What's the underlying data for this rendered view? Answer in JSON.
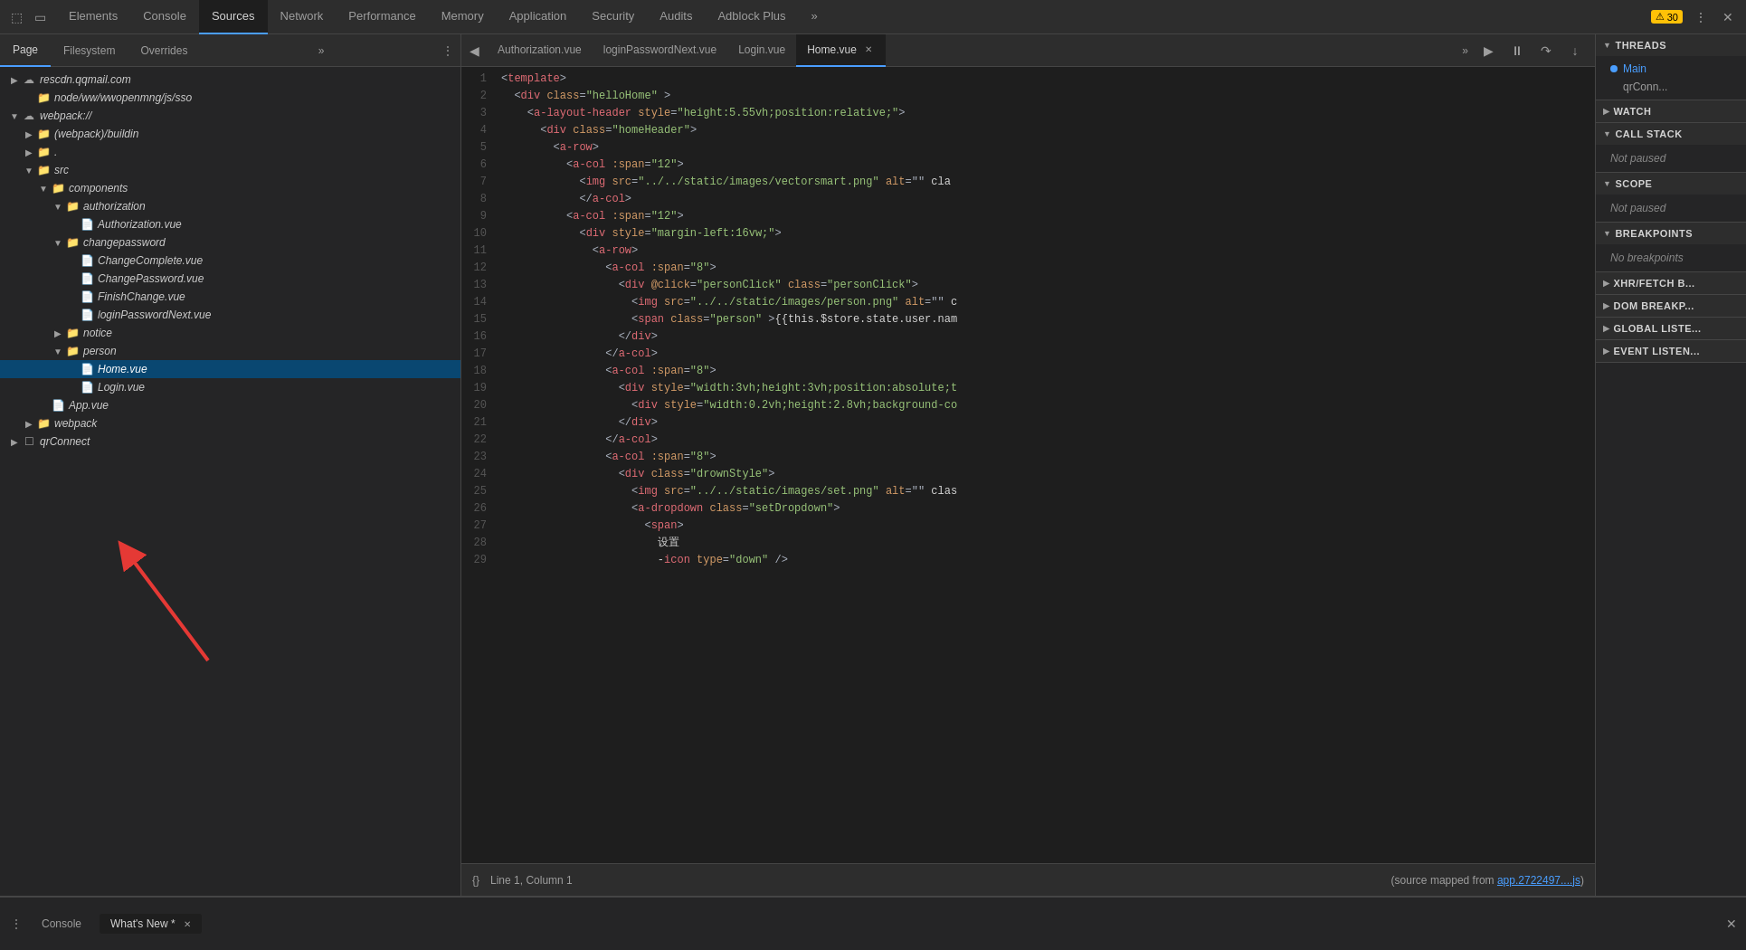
{
  "topNav": {
    "tabs": [
      {
        "label": "Elements",
        "active": false
      },
      {
        "label": "Console",
        "active": false
      },
      {
        "label": "Sources",
        "active": true
      },
      {
        "label": "Network",
        "active": false
      },
      {
        "label": "Performance",
        "active": false
      },
      {
        "label": "Memory",
        "active": false
      },
      {
        "label": "Application",
        "active": false
      },
      {
        "label": "Security",
        "active": false
      },
      {
        "label": "Audits",
        "active": false
      },
      {
        "label": "Adblock Plus",
        "active": false
      }
    ],
    "warningCount": "30",
    "moreLabel": "»"
  },
  "leftPanel": {
    "tabs": [
      {
        "label": "Page",
        "active": true
      },
      {
        "label": "Filesystem",
        "active": false
      },
      {
        "label": "Overrides",
        "active": false
      },
      {
        "label": "»",
        "active": false
      }
    ],
    "tree": [
      {
        "id": "rescdn",
        "label": "rescdn.qqmail.com",
        "indent": 0,
        "type": "cloud",
        "arrow": "closed"
      },
      {
        "id": "node_ww",
        "label": "node/ww/wwopenmng/js/sso",
        "indent": 1,
        "type": "folder-blue",
        "arrow": "none"
      },
      {
        "id": "webpack",
        "label": "webpack://",
        "indent": 0,
        "type": "cloud",
        "arrow": "open"
      },
      {
        "id": "webpack_buildin",
        "label": "(webpack)/buildin",
        "indent": 1,
        "type": "folder",
        "arrow": "closed"
      },
      {
        "id": "dot",
        "label": ".",
        "indent": 1,
        "type": "folder",
        "arrow": "closed"
      },
      {
        "id": "src",
        "label": "src",
        "indent": 1,
        "type": "folder",
        "arrow": "open"
      },
      {
        "id": "components",
        "label": "components",
        "indent": 2,
        "type": "folder",
        "arrow": "open"
      },
      {
        "id": "authorization_folder",
        "label": "authorization",
        "indent": 3,
        "type": "folder",
        "arrow": "open"
      },
      {
        "id": "authorization_file",
        "label": "Authorization.vue",
        "indent": 4,
        "type": "file",
        "arrow": "none"
      },
      {
        "id": "changepassword_folder",
        "label": "changepassword",
        "indent": 3,
        "type": "folder",
        "arrow": "open"
      },
      {
        "id": "changecomplete",
        "label": "ChangeComplete.vue",
        "indent": 4,
        "type": "file",
        "arrow": "none"
      },
      {
        "id": "changepassword_file",
        "label": "ChangePassword.vue",
        "indent": 4,
        "type": "file",
        "arrow": "none"
      },
      {
        "id": "finishchange",
        "label": "FinishChange.vue",
        "indent": 4,
        "type": "file",
        "arrow": "none"
      },
      {
        "id": "loginpasswordnext",
        "label": "loginPasswordNext.vue",
        "indent": 4,
        "type": "file",
        "arrow": "none"
      },
      {
        "id": "notice_folder",
        "label": "notice",
        "indent": 3,
        "type": "folder",
        "arrow": "closed"
      },
      {
        "id": "person_folder",
        "label": "person",
        "indent": 3,
        "type": "folder",
        "arrow": "open"
      },
      {
        "id": "home_vue",
        "label": "Home.vue",
        "indent": 4,
        "type": "file",
        "arrow": "none",
        "selected": true
      },
      {
        "id": "login_vue",
        "label": "Login.vue",
        "indent": 4,
        "type": "file",
        "arrow": "none"
      },
      {
        "id": "app_vue",
        "label": "App.vue",
        "indent": 2,
        "type": "file",
        "arrow": "none"
      },
      {
        "id": "webpack_folder",
        "label": "webpack",
        "indent": 1,
        "type": "folder",
        "arrow": "closed"
      },
      {
        "id": "qrconnect_folder",
        "label": "qrConnect",
        "indent": 0,
        "type": "folder",
        "arrow": "closed"
      }
    ]
  },
  "editorTabs": [
    {
      "label": "Authorization.vue",
      "active": false
    },
    {
      "label": "loginPasswordNext.vue",
      "active": false
    },
    {
      "label": "Login.vue",
      "active": false
    },
    {
      "label": "Home.vue",
      "active": true,
      "closeable": true
    }
  ],
  "codeLines": [
    {
      "num": 1,
      "content": [
        {
          "t": "punct",
          "v": "<"
        },
        {
          "t": "tag",
          "v": "template"
        },
        {
          "t": "punct",
          "v": ">"
        }
      ]
    },
    {
      "num": 2,
      "content": [
        {
          "t": "punct",
          "v": "  <"
        },
        {
          "t": "tag",
          "v": "div"
        },
        {
          "t": "punct",
          "v": " "
        },
        {
          "t": "attr",
          "v": "class"
        },
        {
          "t": "punct",
          "v": "="
        },
        {
          "t": "string",
          "v": "\"helloHome\""
        },
        {
          "t": "punct",
          "v": " >"
        }
      ]
    },
    {
      "num": 3,
      "content": [
        {
          "t": "punct",
          "v": "    <"
        },
        {
          "t": "tag",
          "v": "a-layout-header"
        },
        {
          "t": "punct",
          "v": " "
        },
        {
          "t": "attr",
          "v": "style"
        },
        {
          "t": "punct",
          "v": "="
        },
        {
          "t": "string",
          "v": "\"height:5.55vh;position:relative;\""
        },
        {
          "t": "punct",
          "v": ">"
        }
      ]
    },
    {
      "num": 4,
      "content": [
        {
          "t": "punct",
          "v": "      <"
        },
        {
          "t": "tag",
          "v": "div"
        },
        {
          "t": "punct",
          "v": " "
        },
        {
          "t": "attr",
          "v": "class"
        },
        {
          "t": "punct",
          "v": "="
        },
        {
          "t": "string",
          "v": "\"homeHeader"
        },
        {
          "t": "punct",
          "v": "\">"
        }
      ]
    },
    {
      "num": 5,
      "content": [
        {
          "t": "punct",
          "v": "        <"
        },
        {
          "t": "tag",
          "v": "a-row"
        },
        {
          "t": "punct",
          "v": ">"
        }
      ]
    },
    {
      "num": 6,
      "content": [
        {
          "t": "punct",
          "v": "          <"
        },
        {
          "t": "tag",
          "v": "a-col"
        },
        {
          "t": "punct",
          "v": " :"
        },
        {
          "t": "attr",
          "v": "span"
        },
        {
          "t": "punct",
          "v": "="
        },
        {
          "t": "string",
          "v": "\"12\""
        },
        {
          "t": "punct",
          "v": ">"
        }
      ]
    },
    {
      "num": 7,
      "content": [
        {
          "t": "punct",
          "v": "            <"
        },
        {
          "t": "tag",
          "v": "img"
        },
        {
          "t": "punct",
          "v": " "
        },
        {
          "t": "attr",
          "v": "src"
        },
        {
          "t": "punct",
          "v": "="
        },
        {
          "t": "string",
          "v": "\"../../static/images/vectorsmart.png\""
        },
        {
          "t": "punct",
          "v": " "
        },
        {
          "t": "attr",
          "v": "alt"
        },
        {
          "t": "punct",
          "v": "=\"\" cla"
        }
      ]
    },
    {
      "num": 8,
      "content": [
        {
          "t": "punct",
          "v": "            </"
        },
        {
          "t": "tag",
          "v": "a-col"
        },
        {
          "t": "punct",
          "v": ">"
        }
      ]
    },
    {
      "num": 9,
      "content": [
        {
          "t": "punct",
          "v": "          <"
        },
        {
          "t": "tag",
          "v": "a-col"
        },
        {
          "t": "punct",
          "v": " :"
        },
        {
          "t": "attr",
          "v": "span"
        },
        {
          "t": "punct",
          "v": "="
        },
        {
          "t": "string",
          "v": "\"12\""
        },
        {
          "t": "punct",
          "v": ">"
        }
      ]
    },
    {
      "num": 10,
      "content": [
        {
          "t": "punct",
          "v": "            <"
        },
        {
          "t": "tag",
          "v": "div"
        },
        {
          "t": "punct",
          "v": " "
        },
        {
          "t": "attr",
          "v": "style"
        },
        {
          "t": "punct",
          "v": "="
        },
        {
          "t": "string",
          "v": "\"margin-left:16vw;\""
        },
        {
          "t": "punct",
          "v": ">"
        }
      ]
    },
    {
      "num": 11,
      "content": [
        {
          "t": "punct",
          "v": "              <"
        },
        {
          "t": "tag",
          "v": "a-row"
        },
        {
          "t": "punct",
          "v": ">"
        }
      ]
    },
    {
      "num": 12,
      "content": [
        {
          "t": "punct",
          "v": "                <"
        },
        {
          "t": "tag",
          "v": "a-col"
        },
        {
          "t": "punct",
          "v": " :"
        },
        {
          "t": "attr",
          "v": "span"
        },
        {
          "t": "punct",
          "v": "="
        },
        {
          "t": "string",
          "v": "\"8\""
        },
        {
          "t": "punct",
          "v": ">"
        }
      ]
    },
    {
      "num": 13,
      "content": [
        {
          "t": "punct",
          "v": "                  <"
        },
        {
          "t": "tag",
          "v": "div"
        },
        {
          "t": "punct",
          "v": " "
        },
        {
          "t": "attr",
          "v": "@click"
        },
        {
          "t": "punct",
          "v": "="
        },
        {
          "t": "string",
          "v": "\"personClick\""
        },
        {
          "t": "punct",
          "v": " "
        },
        {
          "t": "attr",
          "v": "class"
        },
        {
          "t": "punct",
          "v": "="
        },
        {
          "t": "string",
          "v": "\"personClick\""
        },
        {
          "t": "punct",
          "v": ">"
        }
      ]
    },
    {
      "num": 14,
      "content": [
        {
          "t": "punct",
          "v": "                    <"
        },
        {
          "t": "tag",
          "v": "img"
        },
        {
          "t": "punct",
          "v": " "
        },
        {
          "t": "attr",
          "v": "src"
        },
        {
          "t": "punct",
          "v": "="
        },
        {
          "t": "string",
          "v": "\"../../static/images/person.png\""
        },
        {
          "t": "punct",
          "v": " "
        },
        {
          "t": "attr",
          "v": "alt"
        },
        {
          "t": "punct",
          "v": "=\"\" c"
        }
      ]
    },
    {
      "num": 15,
      "content": [
        {
          "t": "punct",
          "v": "                    <"
        },
        {
          "t": "tag",
          "v": "span"
        },
        {
          "t": "punct",
          "v": " "
        },
        {
          "t": "attr",
          "v": "class"
        },
        {
          "t": "punct",
          "v": "="
        },
        {
          "t": "string",
          "v": "\"person\""
        },
        {
          "t": "punct",
          "v": " >{{this.$store.state.user.nam"
        }
      ]
    },
    {
      "num": 16,
      "content": [
        {
          "t": "punct",
          "v": "                  </"
        },
        {
          "t": "tag",
          "v": "div"
        },
        {
          "t": "punct",
          "v": ">"
        }
      ]
    },
    {
      "num": 17,
      "content": [
        {
          "t": "punct",
          "v": "                </"
        },
        {
          "t": "tag",
          "v": "a-col"
        },
        {
          "t": "punct",
          "v": ">"
        }
      ]
    },
    {
      "num": 18,
      "content": [
        {
          "t": "punct",
          "v": "                <"
        },
        {
          "t": "tag",
          "v": "a-col"
        },
        {
          "t": "punct",
          "v": " :"
        },
        {
          "t": "attr",
          "v": "span"
        },
        {
          "t": "punct",
          "v": "="
        },
        {
          "t": "string",
          "v": "\"8\""
        },
        {
          "t": "punct",
          "v": ">"
        }
      ]
    },
    {
      "num": 19,
      "content": [
        {
          "t": "punct",
          "v": "                  <"
        },
        {
          "t": "tag",
          "v": "div"
        },
        {
          "t": "punct",
          "v": " "
        },
        {
          "t": "attr",
          "v": "style"
        },
        {
          "t": "punct",
          "v": "="
        },
        {
          "t": "string",
          "v": "\"width:3vh;height:3vh;position:absolute;t"
        }
      ]
    },
    {
      "num": 20,
      "content": [
        {
          "t": "punct",
          "v": "                    <"
        },
        {
          "t": "tag",
          "v": "div"
        },
        {
          "t": "punct",
          "v": " "
        },
        {
          "t": "attr",
          "v": "style"
        },
        {
          "t": "punct",
          "v": "="
        },
        {
          "t": "string",
          "v": "\"width:0.2vh;height:2.8vh;background-co"
        }
      ]
    },
    {
      "num": 21,
      "content": [
        {
          "t": "punct",
          "v": "                  </"
        },
        {
          "t": "tag",
          "v": "div"
        },
        {
          "t": "punct",
          "v": ">"
        }
      ]
    },
    {
      "num": 22,
      "content": [
        {
          "t": "punct",
          "v": "                </"
        },
        {
          "t": "tag",
          "v": "a-col"
        },
        {
          "t": "punct",
          "v": ">"
        }
      ]
    },
    {
      "num": 23,
      "content": [
        {
          "t": "punct",
          "v": "                <"
        },
        {
          "t": "tag",
          "v": "a-col"
        },
        {
          "t": "punct",
          "v": " :"
        },
        {
          "t": "attr",
          "v": "span"
        },
        {
          "t": "punct",
          "v": "="
        },
        {
          "t": "string",
          "v": "\"8\""
        },
        {
          "t": "punct",
          "v": ">"
        }
      ]
    },
    {
      "num": 24,
      "content": [
        {
          "t": "punct",
          "v": "                  <"
        },
        {
          "t": "tag",
          "v": "div"
        },
        {
          "t": "punct",
          "v": " "
        },
        {
          "t": "attr",
          "v": "class"
        },
        {
          "t": "punct",
          "v": "="
        },
        {
          "t": "string",
          "v": "\"drownStyle\""
        },
        {
          "t": "punct",
          "v": ">"
        }
      ]
    },
    {
      "num": 25,
      "content": [
        {
          "t": "punct",
          "v": "                    <"
        },
        {
          "t": "tag",
          "v": "img"
        },
        {
          "t": "punct",
          "v": " "
        },
        {
          "t": "attr",
          "v": "src"
        },
        {
          "t": "punct",
          "v": "="
        },
        {
          "t": "string",
          "v": "\"../../static/images/set.png\""
        },
        {
          "t": "punct",
          "v": " "
        },
        {
          "t": "attr",
          "v": "alt"
        },
        {
          "t": "punct",
          "v": "=\"\" clas"
        }
      ]
    },
    {
      "num": 26,
      "content": [
        {
          "t": "punct",
          "v": "                    <"
        },
        {
          "t": "tag",
          "v": "a-dropdown"
        },
        {
          "t": "punct",
          "v": " "
        },
        {
          "t": "attr",
          "v": "class"
        },
        {
          "t": "punct",
          "v": "="
        },
        {
          "t": "string",
          "v": "\"setDropdown\""
        },
        {
          "t": "punct",
          "v": ">"
        }
      ]
    },
    {
      "num": 27,
      "content": [
        {
          "t": "punct",
          "v": "                      <"
        },
        {
          "t": "tag",
          "v": "span"
        },
        {
          "t": "punct",
          "v": ">"
        }
      ]
    },
    {
      "num": 28,
      "content": [
        {
          "t": "punct",
          "v": "                        设置"
        }
      ]
    },
    {
      "num": 29,
      "content": [
        {
          "t": "punct",
          "v": "                        -"
        },
        {
          "t": "tag",
          "v": "icon"
        },
        {
          "t": "punct",
          "v": " "
        },
        {
          "t": "attr",
          "v": "type"
        },
        {
          "t": "punct",
          "v": "="
        },
        {
          "t": "string",
          "v": "\"down\""
        },
        {
          "t": "punct",
          "v": " />"
        }
      ]
    }
  ],
  "statusBar": {
    "curly": "{}",
    "position": "Line 1, Column 1",
    "sourceMap": "(source mapped from app.2722497....js)"
  },
  "rightPanel": {
    "sections": [
      {
        "id": "threads",
        "label": "Threads",
        "open": true,
        "items": [
          {
            "label": "Main",
            "active": true,
            "dot": true
          },
          {
            "label": "qrConn...",
            "active": false
          }
        ]
      },
      {
        "id": "watch",
        "label": "Watch",
        "open": false,
        "items": []
      },
      {
        "id": "call-stack",
        "label": "Call Stack",
        "open": true,
        "items": [],
        "status": "Not paused"
      },
      {
        "id": "scope",
        "label": "Scope",
        "open": true,
        "items": [],
        "status": "Not paused"
      },
      {
        "id": "breakpoints",
        "label": "Breakpoints",
        "open": true,
        "items": [],
        "status": "No breakpoints"
      },
      {
        "id": "xhr-fetch",
        "label": "XHR/fetch B...",
        "open": false,
        "items": []
      },
      {
        "id": "dom-breakpoints",
        "label": "DOM Breakp...",
        "open": false,
        "items": []
      },
      {
        "id": "global-listeners",
        "label": "Global Liste...",
        "open": false,
        "items": []
      },
      {
        "id": "event-listeners",
        "label": "Event Listen...",
        "open": false,
        "items": []
      }
    ]
  },
  "bottomPanel": {
    "leftIcon": "⋮",
    "consoleLabel": "Console",
    "whatsNewLabel": "What's New",
    "whatsNewStar": "*",
    "closeIcon": "✕"
  }
}
